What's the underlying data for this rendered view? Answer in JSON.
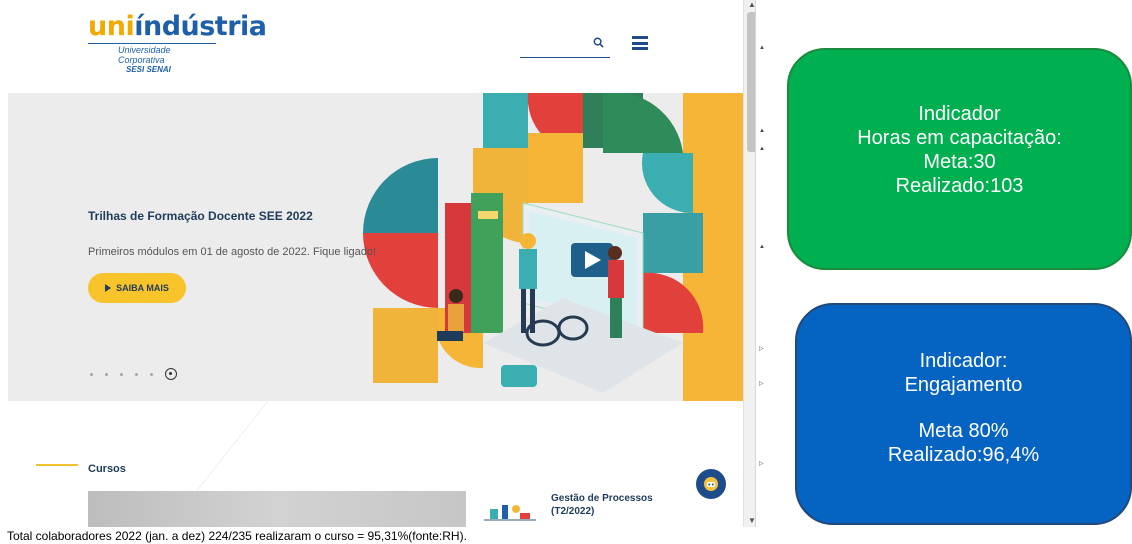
{
  "site": {
    "logo": {
      "brand_part1": "uni",
      "brand_part2": "ndústria",
      "brand_accent": "í",
      "subtitle": "Universidade Corporativa",
      "subtitle2": "SESI SENAI"
    },
    "header": {
      "search_placeholder": "",
      "search_icon": "search-icon",
      "menu_icon": "hamburger-menu-icon"
    },
    "hero": {
      "title": "Trilhas de Formação Docente SEE 2022",
      "subtitle": "Primeiros módulos em 01 de agosto de 2022. Fique ligado!",
      "button_label": "SAIBA MAIS",
      "slide_count": 6,
      "active_slide": 6
    },
    "courses": {
      "section_title": "Cursos",
      "course_name": "Gestão de Processos (T2/2022)"
    },
    "colors": {
      "accent_yellow": "#f9c32c",
      "brand_blue": "#1e5fa8",
      "hero_bg": "#ececec"
    }
  },
  "caption": "Total colaboradores 2022 (jan. a dez) 224/235 realizaram o curso = 95,31%(fonte:RH).",
  "indicators": {
    "green": {
      "line1": "Indicador",
      "line2": "Horas em capacitação:",
      "line3": "Meta:30",
      "line4": "Realizado:103",
      "color": "#00b050"
    },
    "blue": {
      "line1": "Indicador:",
      "line2": "Engajamento",
      "line3": "Meta 80%",
      "line4": "Realizado:96,4%",
      "color": "#0563c1"
    }
  }
}
